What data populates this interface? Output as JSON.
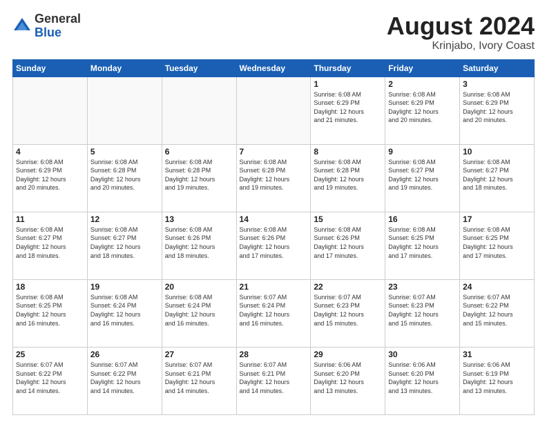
{
  "header": {
    "logo_general": "General",
    "logo_blue": "Blue",
    "main_title": "August 2024",
    "subtitle": "Krinjabo, Ivory Coast"
  },
  "calendar": {
    "weekdays": [
      "Sunday",
      "Monday",
      "Tuesday",
      "Wednesday",
      "Thursday",
      "Friday",
      "Saturday"
    ],
    "weeks": [
      [
        {
          "day": "",
          "info": ""
        },
        {
          "day": "",
          "info": ""
        },
        {
          "day": "",
          "info": ""
        },
        {
          "day": "",
          "info": ""
        },
        {
          "day": "1",
          "info": "Sunrise: 6:08 AM\nSunset: 6:29 PM\nDaylight: 12 hours\nand 21 minutes."
        },
        {
          "day": "2",
          "info": "Sunrise: 6:08 AM\nSunset: 6:29 PM\nDaylight: 12 hours\nand 20 minutes."
        },
        {
          "day": "3",
          "info": "Sunrise: 6:08 AM\nSunset: 6:29 PM\nDaylight: 12 hours\nand 20 minutes."
        }
      ],
      [
        {
          "day": "4",
          "info": "Sunrise: 6:08 AM\nSunset: 6:29 PM\nDaylight: 12 hours\nand 20 minutes."
        },
        {
          "day": "5",
          "info": "Sunrise: 6:08 AM\nSunset: 6:28 PM\nDaylight: 12 hours\nand 20 minutes."
        },
        {
          "day": "6",
          "info": "Sunrise: 6:08 AM\nSunset: 6:28 PM\nDaylight: 12 hours\nand 19 minutes."
        },
        {
          "day": "7",
          "info": "Sunrise: 6:08 AM\nSunset: 6:28 PM\nDaylight: 12 hours\nand 19 minutes."
        },
        {
          "day": "8",
          "info": "Sunrise: 6:08 AM\nSunset: 6:28 PM\nDaylight: 12 hours\nand 19 minutes."
        },
        {
          "day": "9",
          "info": "Sunrise: 6:08 AM\nSunset: 6:27 PM\nDaylight: 12 hours\nand 19 minutes."
        },
        {
          "day": "10",
          "info": "Sunrise: 6:08 AM\nSunset: 6:27 PM\nDaylight: 12 hours\nand 18 minutes."
        }
      ],
      [
        {
          "day": "11",
          "info": "Sunrise: 6:08 AM\nSunset: 6:27 PM\nDaylight: 12 hours\nand 18 minutes."
        },
        {
          "day": "12",
          "info": "Sunrise: 6:08 AM\nSunset: 6:27 PM\nDaylight: 12 hours\nand 18 minutes."
        },
        {
          "day": "13",
          "info": "Sunrise: 6:08 AM\nSunset: 6:26 PM\nDaylight: 12 hours\nand 18 minutes."
        },
        {
          "day": "14",
          "info": "Sunrise: 6:08 AM\nSunset: 6:26 PM\nDaylight: 12 hours\nand 17 minutes."
        },
        {
          "day": "15",
          "info": "Sunrise: 6:08 AM\nSunset: 6:26 PM\nDaylight: 12 hours\nand 17 minutes."
        },
        {
          "day": "16",
          "info": "Sunrise: 6:08 AM\nSunset: 6:25 PM\nDaylight: 12 hours\nand 17 minutes."
        },
        {
          "day": "17",
          "info": "Sunrise: 6:08 AM\nSunset: 6:25 PM\nDaylight: 12 hours\nand 17 minutes."
        }
      ],
      [
        {
          "day": "18",
          "info": "Sunrise: 6:08 AM\nSunset: 6:25 PM\nDaylight: 12 hours\nand 16 minutes."
        },
        {
          "day": "19",
          "info": "Sunrise: 6:08 AM\nSunset: 6:24 PM\nDaylight: 12 hours\nand 16 minutes."
        },
        {
          "day": "20",
          "info": "Sunrise: 6:08 AM\nSunset: 6:24 PM\nDaylight: 12 hours\nand 16 minutes."
        },
        {
          "day": "21",
          "info": "Sunrise: 6:07 AM\nSunset: 6:24 PM\nDaylight: 12 hours\nand 16 minutes."
        },
        {
          "day": "22",
          "info": "Sunrise: 6:07 AM\nSunset: 6:23 PM\nDaylight: 12 hours\nand 15 minutes."
        },
        {
          "day": "23",
          "info": "Sunrise: 6:07 AM\nSunset: 6:23 PM\nDaylight: 12 hours\nand 15 minutes."
        },
        {
          "day": "24",
          "info": "Sunrise: 6:07 AM\nSunset: 6:22 PM\nDaylight: 12 hours\nand 15 minutes."
        }
      ],
      [
        {
          "day": "25",
          "info": "Sunrise: 6:07 AM\nSunset: 6:22 PM\nDaylight: 12 hours\nand 14 minutes."
        },
        {
          "day": "26",
          "info": "Sunrise: 6:07 AM\nSunset: 6:22 PM\nDaylight: 12 hours\nand 14 minutes."
        },
        {
          "day": "27",
          "info": "Sunrise: 6:07 AM\nSunset: 6:21 PM\nDaylight: 12 hours\nand 14 minutes."
        },
        {
          "day": "28",
          "info": "Sunrise: 6:07 AM\nSunset: 6:21 PM\nDaylight: 12 hours\nand 14 minutes."
        },
        {
          "day": "29",
          "info": "Sunrise: 6:06 AM\nSunset: 6:20 PM\nDaylight: 12 hours\nand 13 minutes."
        },
        {
          "day": "30",
          "info": "Sunrise: 6:06 AM\nSunset: 6:20 PM\nDaylight: 12 hours\nand 13 minutes."
        },
        {
          "day": "31",
          "info": "Sunrise: 6:06 AM\nSunset: 6:19 PM\nDaylight: 12 hours\nand 13 minutes."
        }
      ]
    ]
  }
}
